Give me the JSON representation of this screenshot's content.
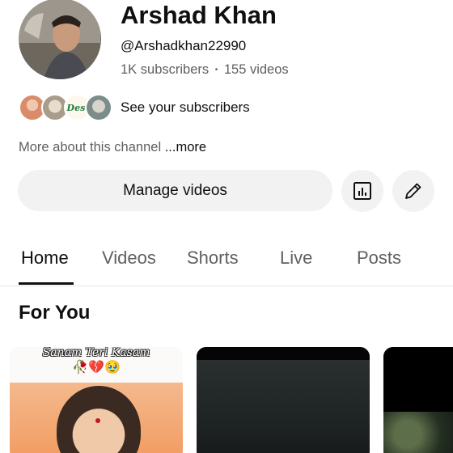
{
  "channel": {
    "name": "Arshad Khan",
    "handle": "@Arshadkhan22990",
    "subscribers": "1K subscribers",
    "separator": "•",
    "videos": "155 videos"
  },
  "subscribers_row": {
    "link_label": "See your subscribers",
    "avatar_badge_text": "Desi"
  },
  "about": {
    "text": "More about this channel ",
    "more_label": "...more"
  },
  "actions": {
    "manage_videos_label": "Manage videos",
    "analytics_icon": "analytics-icon",
    "edit_icon": "pencil-icon"
  },
  "tabs": [
    {
      "label": "Home",
      "active": true
    },
    {
      "label": "Videos",
      "active": false
    },
    {
      "label": "Shorts",
      "active": false
    },
    {
      "label": "Live",
      "active": false
    },
    {
      "label": "Posts",
      "active": false
    }
  ],
  "section": {
    "title": "For You"
  },
  "cards": [
    {
      "caption": "Sanam Teri Kasam",
      "emoji": "🥀💔🥹"
    },
    {
      "caption": ""
    },
    {
      "caption": ""
    }
  ],
  "colors": {
    "text_primary": "#0f0f0f",
    "text_secondary": "#606060",
    "button_bg": "#f2f2f2",
    "divider": "#e6e6e6"
  }
}
